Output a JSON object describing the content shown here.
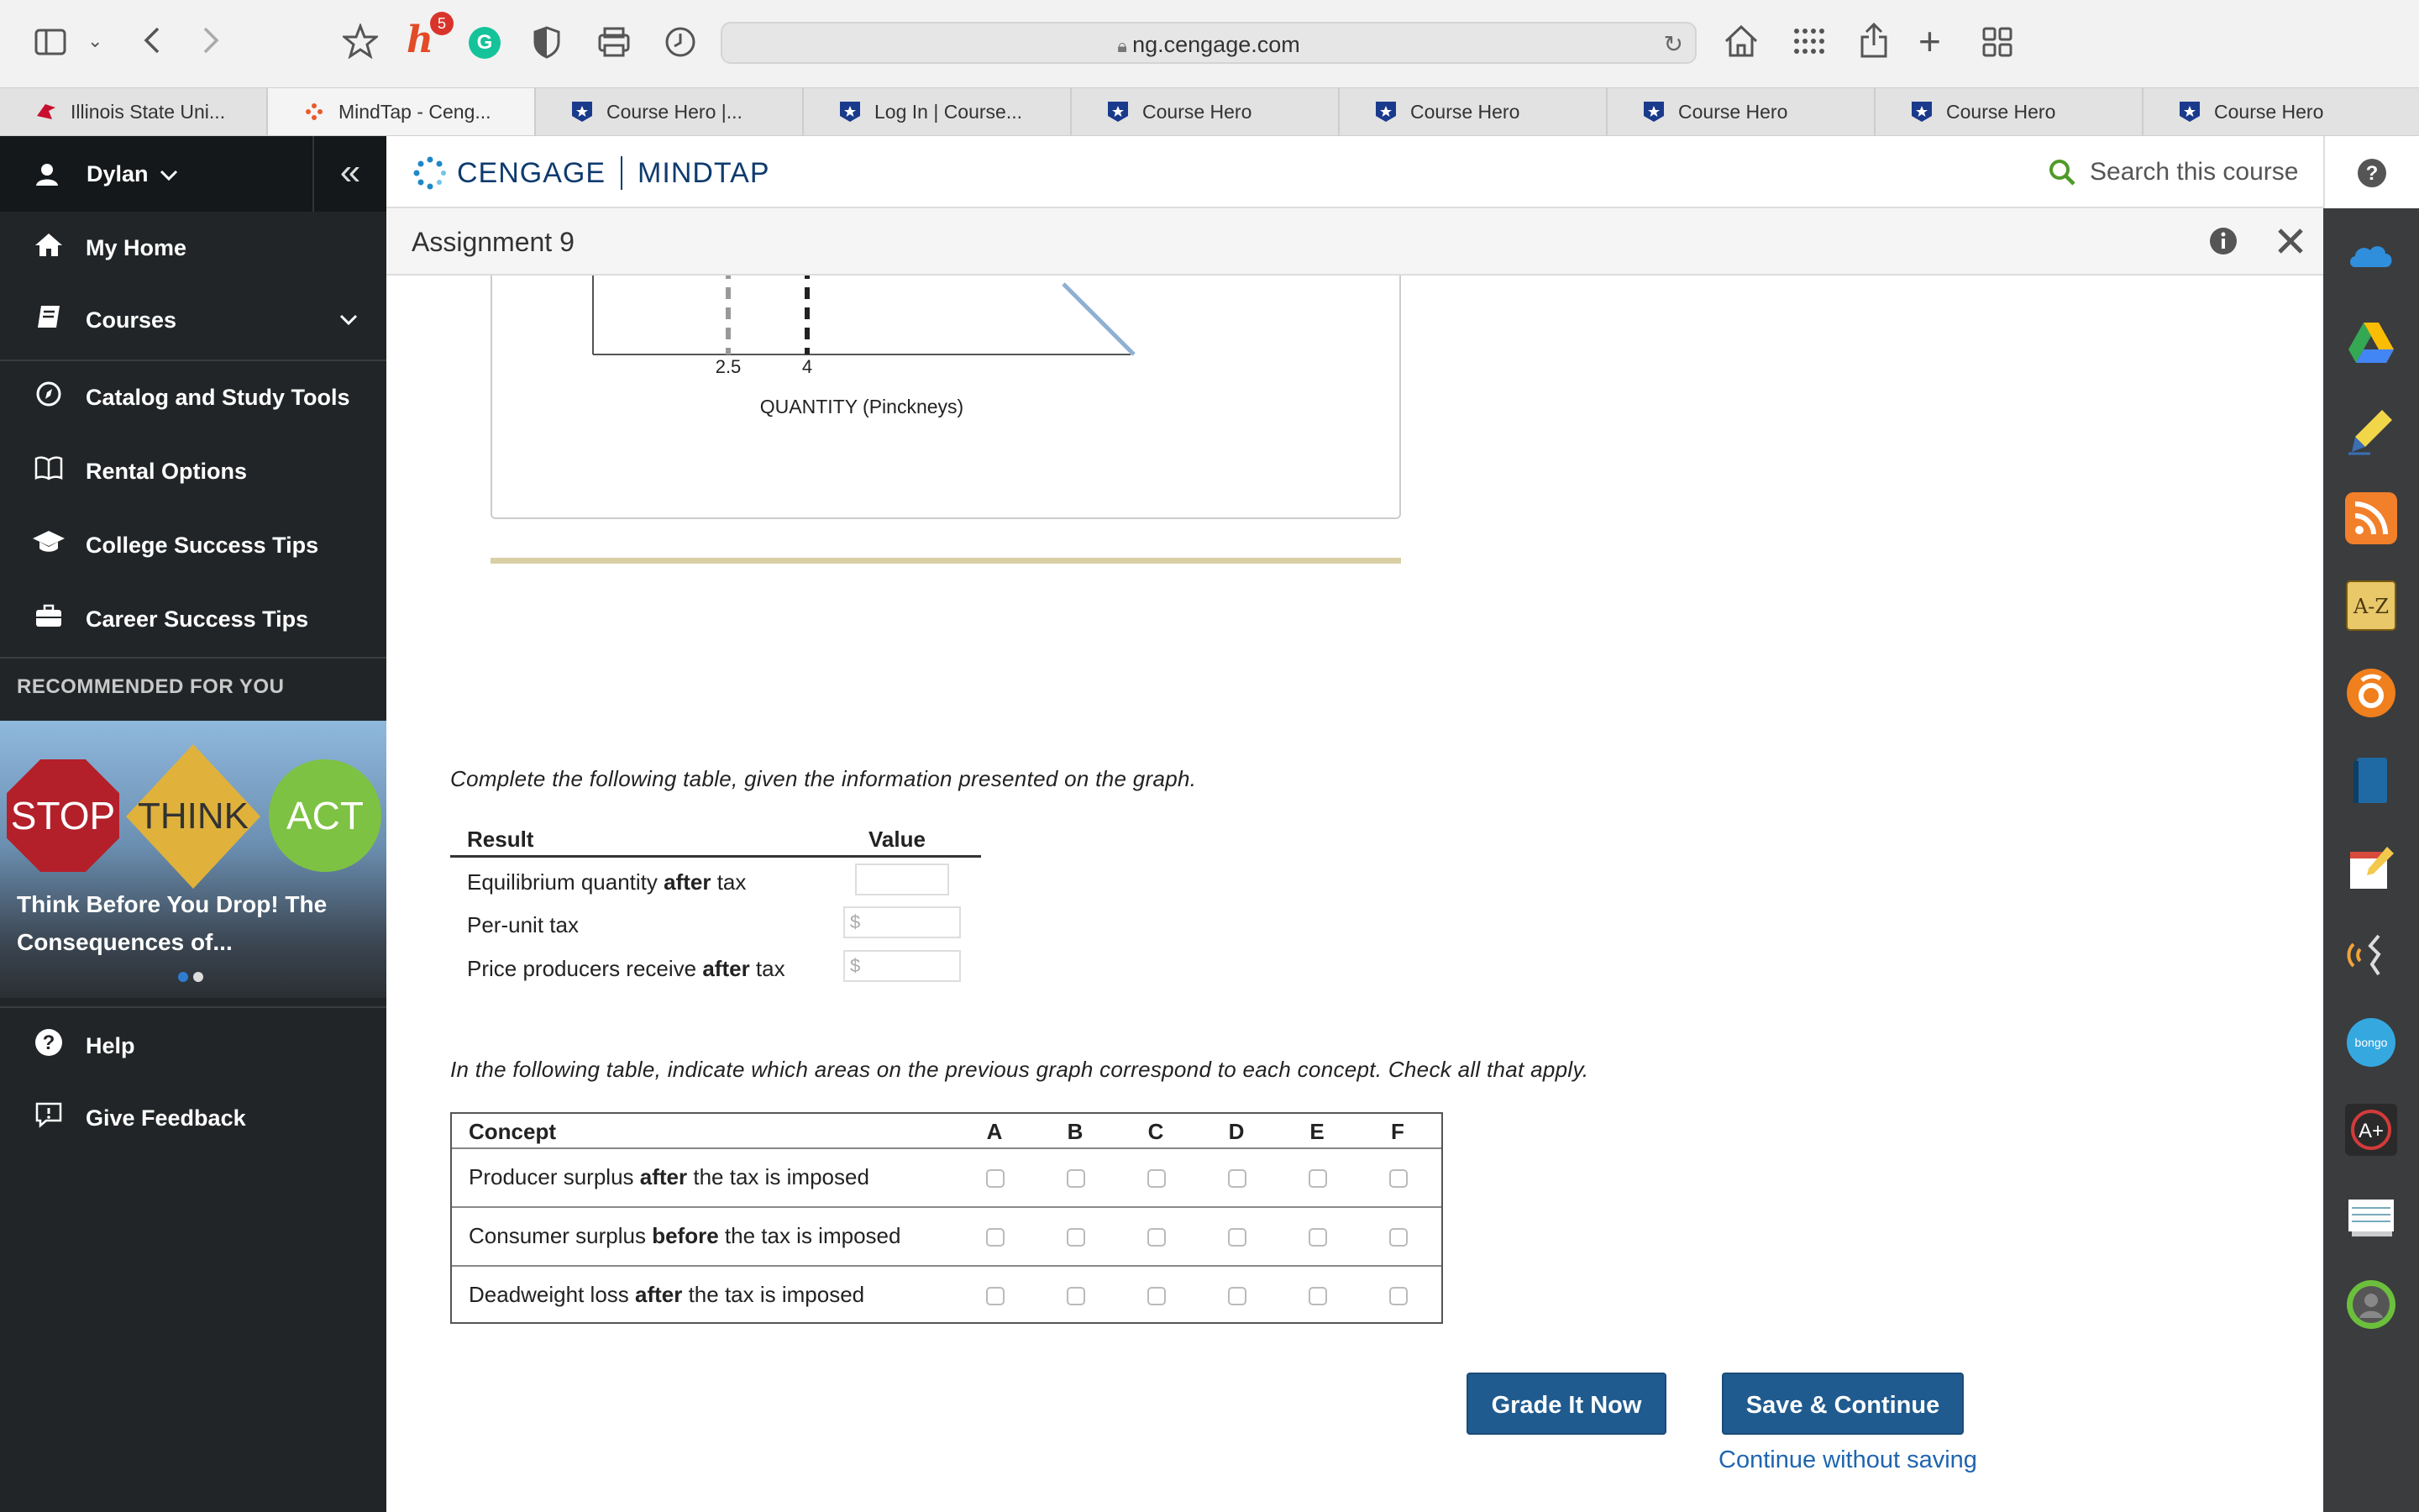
{
  "browser": {
    "url": "ng.cengage.com",
    "notification_count": "5",
    "tabs": [
      {
        "label": "Illinois State Uni..."
      },
      {
        "label": "MindTap - Ceng..."
      },
      {
        "label": "Course Hero |..."
      },
      {
        "label": "Log In | Course..."
      },
      {
        "label": "Course Hero"
      },
      {
        "label": "Course Hero"
      },
      {
        "label": "Course Hero"
      },
      {
        "label": "Course Hero"
      },
      {
        "label": "Course Hero"
      }
    ]
  },
  "sidebar": {
    "user": "Dylan",
    "items": [
      {
        "label": "My Home",
        "icon": "home-icon"
      },
      {
        "label": "Courses",
        "icon": "book-icon"
      },
      {
        "label": "Catalog and Study Tools",
        "icon": "compass-icon"
      },
      {
        "label": "Rental Options",
        "icon": "open-book-icon"
      },
      {
        "label": "College Success Tips",
        "icon": "graduation-cap-icon"
      },
      {
        "label": "Career Success Tips",
        "icon": "briefcase-icon"
      }
    ],
    "recommended_title": "RECOMMENDED FOR YOU",
    "recommended": {
      "signs": [
        "STOP",
        "THINK",
        "ACT"
      ],
      "caption": "Think Before You Drop! The Consequences of..."
    },
    "bottom_items": [
      {
        "label": "Help",
        "icon": "help-icon"
      },
      {
        "label": "Give Feedback",
        "icon": "feedback-icon"
      }
    ]
  },
  "header": {
    "brand_left": "CENGAGE",
    "brand_right": "MINDTAP",
    "search_placeholder": "Search this course"
  },
  "assignment": {
    "title": "Assignment 9"
  },
  "graph": {
    "tick_labels": [
      "2.5",
      "4"
    ],
    "x_axis_label": "QUANTITY (Pinckneys)"
  },
  "instructions": {
    "table1": "Complete the following table, given the information presented on the graph.",
    "table2": "In the following table, indicate which areas on the previous graph correspond to each concept. Check all that apply."
  },
  "result_table": {
    "headers": {
      "result": "Result",
      "value": "Value"
    },
    "rows": [
      {
        "pre": "Equilibrium quantity ",
        "bold": "after",
        "post": " tax",
        "prefix": ""
      },
      {
        "pre": "Per-unit tax",
        "bold": "",
        "post": "",
        "prefix": "$"
      },
      {
        "pre": "Price producers receive ",
        "bold": "after",
        "post": " tax",
        "prefix": "$"
      }
    ]
  },
  "concept_table": {
    "header": "Concept",
    "columns": [
      "A",
      "B",
      "C",
      "D",
      "E",
      "F"
    ],
    "rows": [
      {
        "pre": "Producer surplus ",
        "bold": "after",
        "post": " the tax is imposed"
      },
      {
        "pre": "Consumer surplus ",
        "bold": "before",
        "post": " the tax is imposed"
      },
      {
        "pre": "Deadweight loss ",
        "bold": "after",
        "post": " the tax is imposed"
      }
    ]
  },
  "actions": {
    "grade": "Grade It Now",
    "save": "Save & Continue",
    "continue": "Continue without saving"
  },
  "colors": {
    "button": "#205b8f",
    "sidebar": "#222527",
    "demand_line": "#8fb0d4",
    "link": "#1f65b0"
  }
}
